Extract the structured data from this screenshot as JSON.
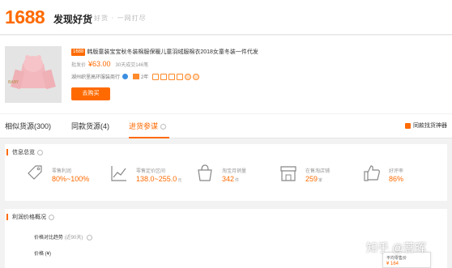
{
  "header": {
    "logo": "1688",
    "brand": "发现好货",
    "slogan": "好货 · 一网打尽"
  },
  "product": {
    "tag": "1688",
    "title": "韩版童装宝宝秋冬装棉服保暖儿童羽绒服棉衣2018女童冬装一件代发",
    "price_label": "批发价",
    "price": "¥63.00",
    "sold": "30天成交146笔",
    "shop": "湖州织里高环服装商行",
    "years": "2年",
    "buy_button": "去购买"
  },
  "tabs": {
    "similar": "相似货源(300)",
    "same": "同款货源(4)",
    "reference": "进货参谋",
    "find_same": "同款找货神器"
  },
  "info": {
    "title": "信息总览",
    "metrics": [
      {
        "label": "零售利润",
        "value": "80%~100%",
        "unit": "",
        "icon": "price-tag-icon"
      },
      {
        "label": "零售定价区间",
        "value": "138.0~255.0",
        "unit": "元",
        "icon": "trend-chart-icon"
      },
      {
        "label": "淘宝月销量",
        "value": "342",
        "unit": "件",
        "icon": "shopping-bag-icon"
      },
      {
        "label": "在售淘店铺",
        "value": "259",
        "unit": "家",
        "icon": "store-icon"
      },
      {
        "label": "好评率",
        "value": "86%",
        "unit": "",
        "icon": "thumbs-up-icon"
      }
    ]
  },
  "price_overview": {
    "title": "利润价格概况",
    "trend_label": "价格对比趋势",
    "trend_period": "(近90天)",
    "price_axis": "价格 (¥)",
    "popup_label": "平均零售价",
    "popup_value": "¥ 164"
  },
  "watermark": "知乎 @菩晖",
  "colors": {
    "accent": "#ff6a00",
    "background": "#f2f2f2"
  }
}
